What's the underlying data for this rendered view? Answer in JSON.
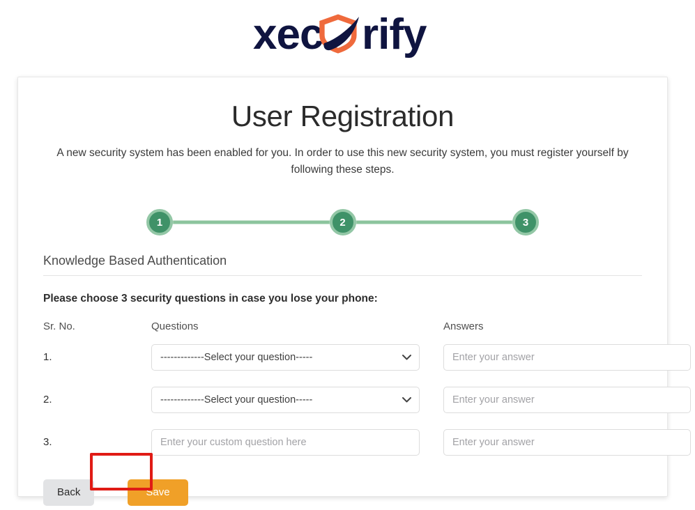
{
  "brand": {
    "name": "xecurify",
    "text_before": "xec",
    "text_after": "rify",
    "icon": "shield-swoosh-logo",
    "colors": {
      "wordmark": "#0f1440",
      "shield": "#ef6a3c",
      "swoosh": "#0f1440"
    }
  },
  "page": {
    "title": "User Registration",
    "subtitle": "A new security system has been enabled for you. In order to use this new security system, you must register yourself by following these steps."
  },
  "stepper": {
    "steps": [
      {
        "number": "1",
        "state": "active"
      },
      {
        "number": "2",
        "state": "active"
      },
      {
        "number": "3",
        "state": "active"
      }
    ],
    "colors": {
      "circle": "#3f9268",
      "ring": "#93c7a6",
      "line": "#8cc49d"
    }
  },
  "section": {
    "title": "Knowledge Based Authentication",
    "instruction": "Please choose 3 security questions in case you lose your phone:"
  },
  "table": {
    "headers": {
      "sr": "Sr. No.",
      "questions": "Questions",
      "answers": "Answers"
    },
    "rows": [
      {
        "sr": "1.",
        "question_type": "select",
        "question_value": "-------------Select your question-----",
        "answer_placeholder": "Enter your answer",
        "answer_value": ""
      },
      {
        "sr": "2.",
        "question_type": "select",
        "question_value": "-------------Select your question-----",
        "answer_placeholder": "Enter your answer",
        "answer_value": ""
      },
      {
        "sr": "3.",
        "question_type": "text",
        "question_placeholder": "Enter your custom question here",
        "question_value": "",
        "answer_placeholder": "Enter your answer",
        "answer_value": ""
      }
    ]
  },
  "buttons": {
    "back": "Back",
    "save": "Save",
    "save_color": "#f0a028",
    "back_color": "#e2e3e5"
  },
  "annotation": {
    "target": "save-button",
    "color": "#e01b15"
  }
}
